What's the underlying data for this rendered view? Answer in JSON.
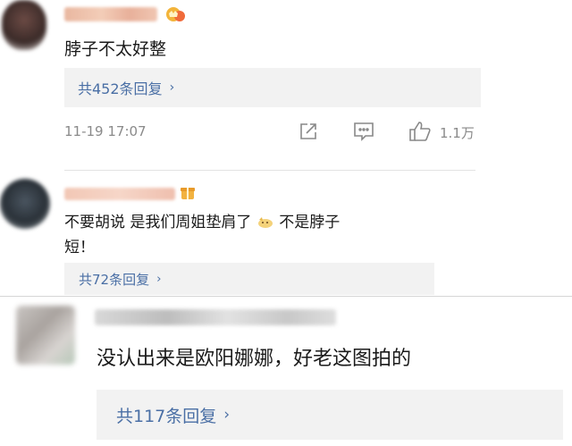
{
  "comments": [
    {
      "text": "脖子不太好整",
      "replies_label": "共452条回复",
      "timestamp": "11-19 17:07",
      "like_count": "1.1万",
      "icons": [
        "share-icon",
        "comment-icon",
        "like-icon"
      ],
      "badge_icon": "crown-icon"
    },
    {
      "text_line1": "不要胡说 是我们周姐垫肩了",
      "emoji": "dog-emoji",
      "text_line1_end": "不是脖子",
      "text_line2": "短！",
      "replies_label": "共72条回复",
      "badge_icon": "gift-icon"
    },
    {
      "text": "没认出来是欧阳娜娜，好老这图拍的",
      "replies_label": "共117条回复"
    }
  ],
  "chevron": "›",
  "colors": {
    "link": "#4a6fa5",
    "reply_bg": "#f2f2f2",
    "meta_text": "#8a8a8a",
    "divider": "#e3e3e3"
  }
}
